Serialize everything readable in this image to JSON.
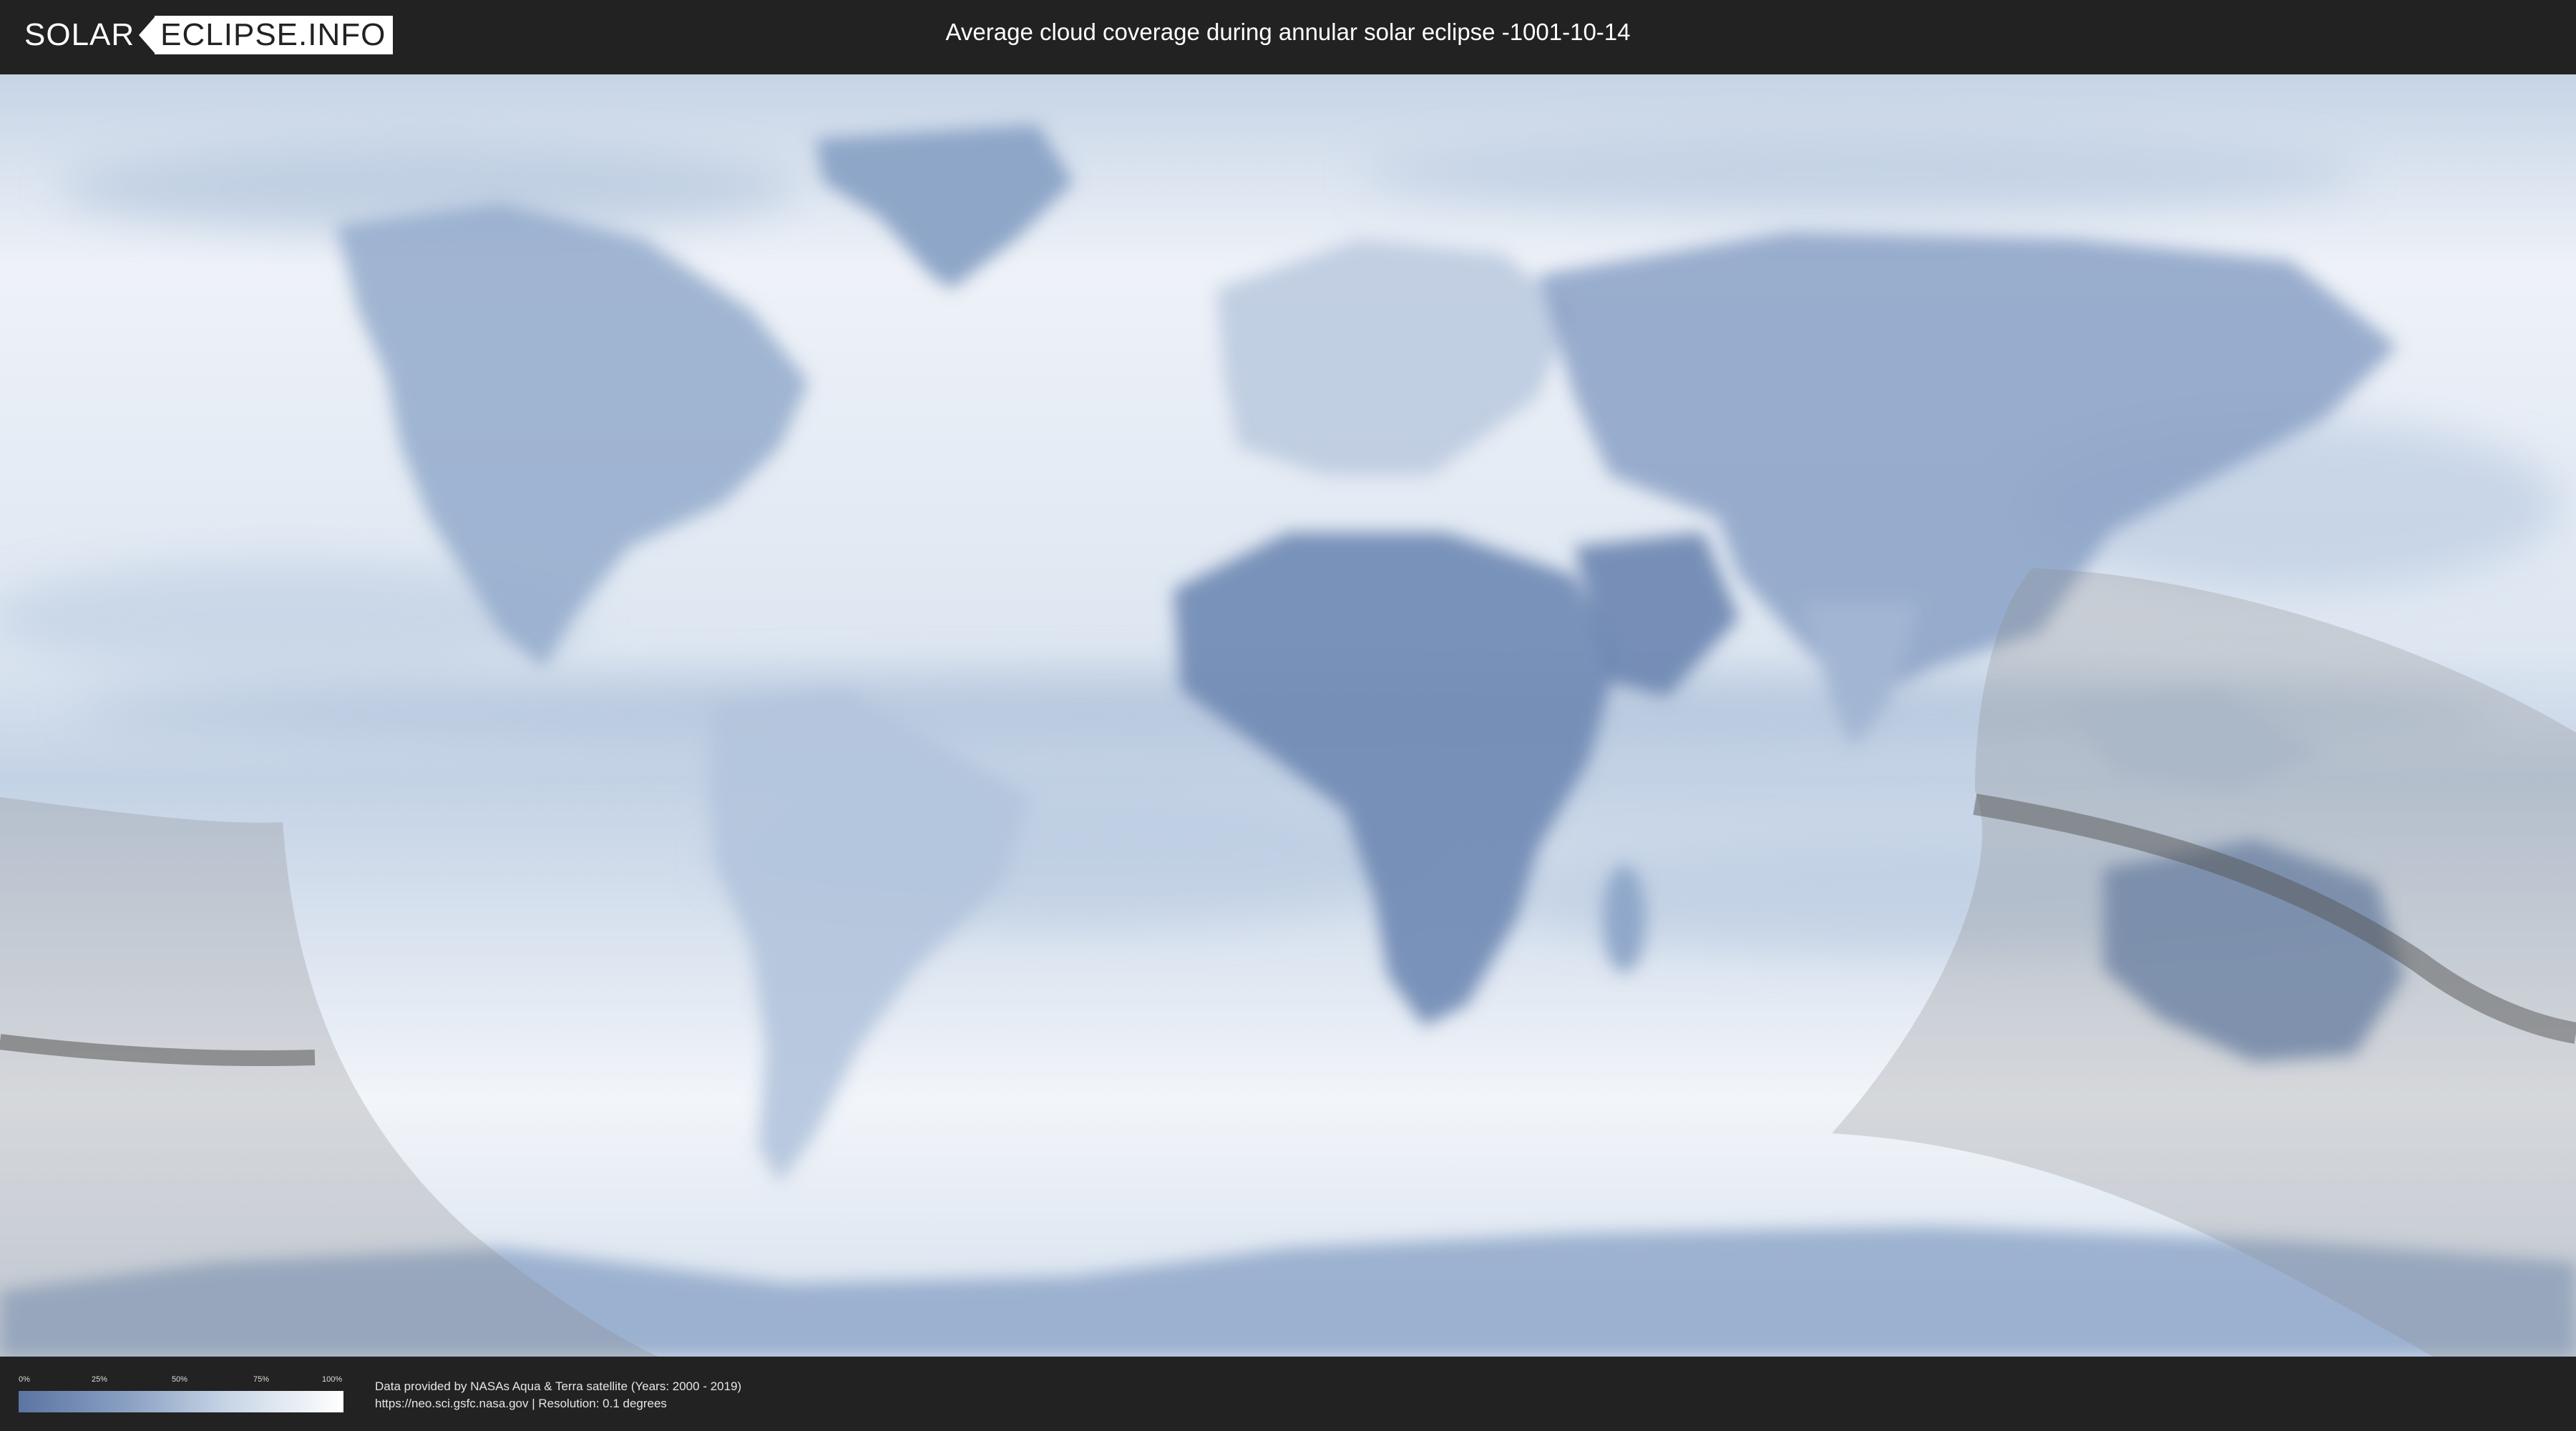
{
  "header": {
    "logo_solar": "SOLAR",
    "logo_eclipse": "ECLIPSE.INFO",
    "title": "Average cloud coverage during annular solar eclipse -1001-10-14"
  },
  "map": {
    "projection": "equirectangular",
    "colors": {
      "clear_sky": "#4f6c9c",
      "full_cloud": "#ffffff",
      "penumbra_shade": "#8a8a8a",
      "central_path": "#555555"
    }
  },
  "legend": {
    "ticks": [
      "0%",
      "25%",
      "50%",
      "75%",
      "100%"
    ]
  },
  "footer": {
    "credit_line1": "Data provided by NASAs Aqua & Terra satellite (Years: 2000 - 2019)",
    "credit_line2": "https://neo.sci.gsfc.nasa.gov | Resolution: 0.1 degrees"
  }
}
